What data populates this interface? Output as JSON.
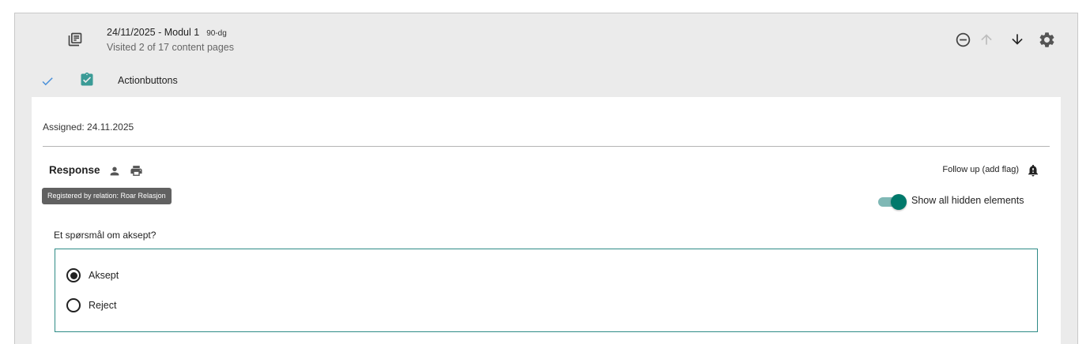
{
  "module": {
    "title": "24/11/2025 - Modul 1",
    "tag": "90-dg",
    "subtitle": "Visited 2 of 17 content pages"
  },
  "toolbar": {
    "buttons": [
      {
        "icon": "minus-circle-icon",
        "enabled": true
      },
      {
        "icon": "arrow-up-icon",
        "enabled": false
      },
      {
        "icon": "arrow-down-icon",
        "enabled": true
      },
      {
        "icon": "gear-icon",
        "enabled": true
      }
    ]
  },
  "section": {
    "label": "Actionbuttons",
    "status_icon": "check-icon",
    "type_icon": "clipboard-check-icon"
  },
  "panel": {
    "assigned": "Assigned: 24.11.2025",
    "response_title": "Response",
    "tooltip": "Registered by relation: Roar Relasjon",
    "follow_up_label": "Follow up (add flag)",
    "toggle_label": "Show all hidden elements",
    "toggle_on": true,
    "question": "Et spørsmål om aksept?",
    "options": [
      {
        "label": "Aksept",
        "selected": true
      },
      {
        "label": "Reject",
        "selected": false
      }
    ]
  },
  "colors": {
    "accent": "#00796b",
    "accent_light": "#7fb8b5",
    "box_border": "#2e8b86",
    "check_blue": "#4a90d9",
    "clipboard_teal": "#3a9b96",
    "header_bg": "#ebebeb"
  }
}
